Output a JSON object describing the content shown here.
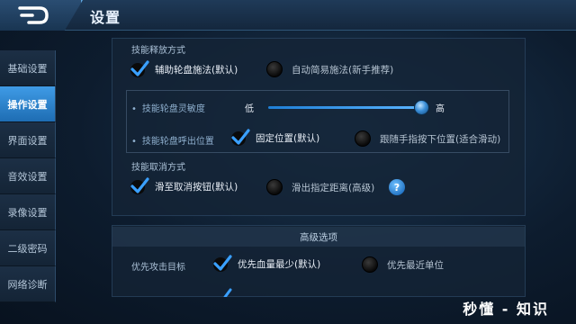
{
  "header": {
    "title": "设置"
  },
  "sidebar": {
    "items": [
      {
        "label": "基础设置",
        "active": false
      },
      {
        "label": "操作设置",
        "active": true
      },
      {
        "label": "界面设置",
        "active": false
      },
      {
        "label": "音效设置",
        "active": false
      },
      {
        "label": "录像设置",
        "active": false
      },
      {
        "label": "二级密码",
        "active": false
      },
      {
        "label": "网络诊断",
        "active": false
      }
    ]
  },
  "skill_cast": {
    "title": "技能释放方式",
    "option_a": "辅助轮盘施法(默认)",
    "option_b": "自动简易施法(新手推荐)",
    "selected": "option_a"
  },
  "wheel": {
    "sensitivity_label": "技能轮盘灵敏度",
    "low": "低",
    "high": "高",
    "sensitivity_level": 0.98,
    "position_label": "技能轮盘呼出位置",
    "pos_a": "固定位置(默认)",
    "pos_b": "跟随手指按下位置(适合滑动)",
    "selected": "pos_a"
  },
  "skill_cancel": {
    "title": "技能取消方式",
    "option_a": "滑至取消按钮(默认)",
    "option_b": "滑出指定距离(高级)",
    "help": "?",
    "selected": "option_a"
  },
  "advanced": {
    "title": "高级选项",
    "target_label": "优先攻击目标",
    "option_a": "优先血量最少(默认)",
    "option_b": "优先最近单位",
    "selected": "option_a"
  },
  "watermark": "秒懂 - 知识",
  "colors": {
    "accent": "#3f9be6",
    "check": "#3aa0ff"
  }
}
